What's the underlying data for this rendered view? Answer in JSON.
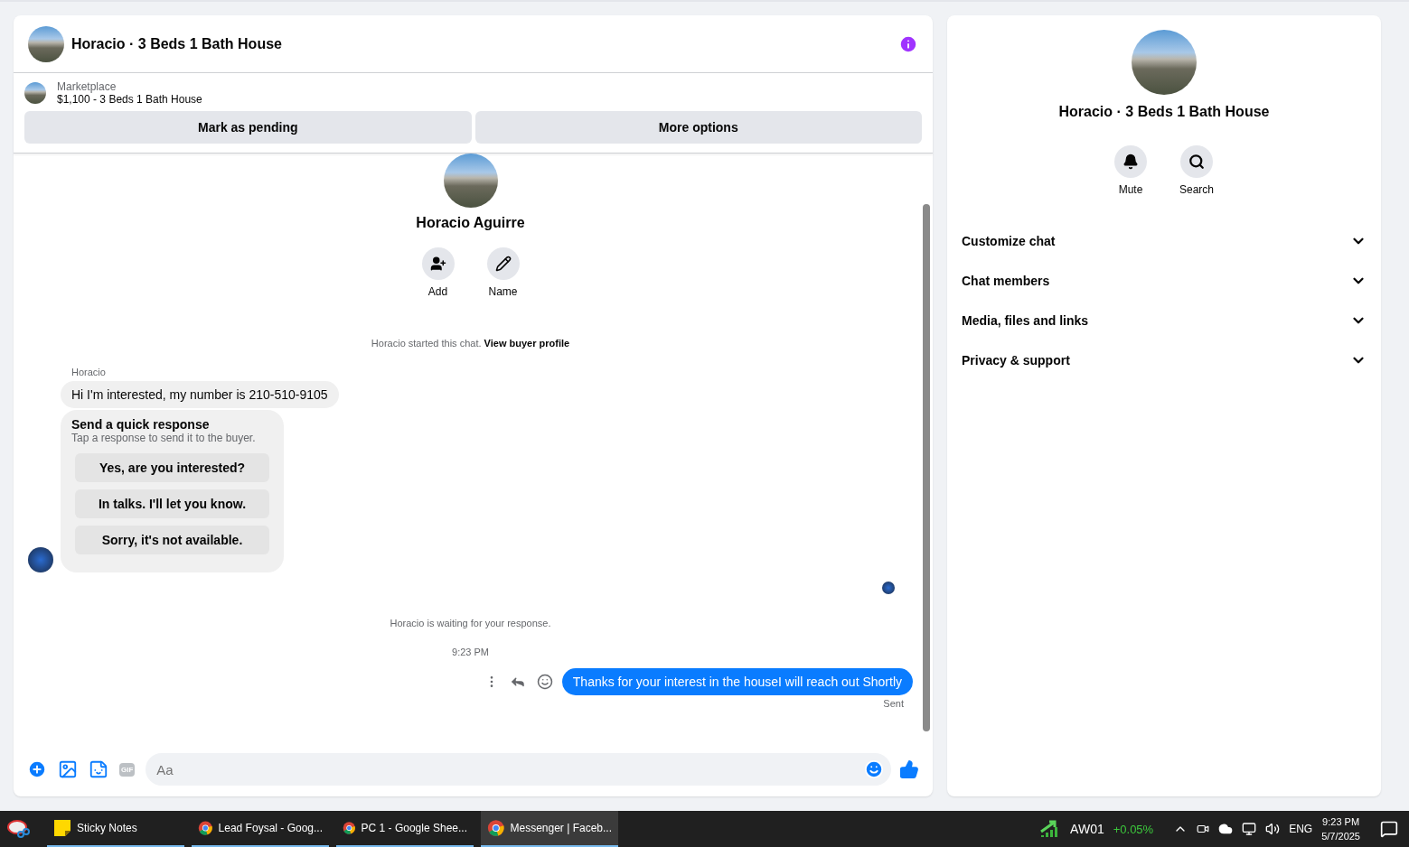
{
  "header": {
    "title": "Horacio · 3 Beds 1 Bath House"
  },
  "listing": {
    "source": "Marketplace",
    "title": "$1,100 - 3 Beds 1 Bath House",
    "actions": [
      "Mark as pending",
      "More options"
    ]
  },
  "profile": {
    "name": "Horacio Aguirre",
    "actions": [
      {
        "label": "Add",
        "kind": "add"
      },
      {
        "label": "Name",
        "kind": "edit"
      }
    ]
  },
  "start_note": {
    "text": "Horacio started this chat.",
    "link": "View buyer profile"
  },
  "incoming": {
    "sender": "Horacio",
    "message": "Hi I'm interested, my number is 210-510-9105"
  },
  "quick_response": {
    "title": "Send a quick response",
    "subtitle": "Tap a response to send it to the buyer.",
    "options": [
      "Yes, are you interested?",
      "In talks. I'll let you know.",
      "Sorry, it's not available."
    ]
  },
  "waiting_note": "Horacio is waiting for your response.",
  "timestamp": "9:23 PM",
  "outgoing": {
    "message": "Thanks for your interest in the houseI will reach out Shortly",
    "status": "Sent"
  },
  "composer": {
    "placeholder": "Aa",
    "gif_label": "GIF"
  },
  "details": {
    "title": "Horacio · 3 Beds 1 Bath House",
    "actions": [
      {
        "label": "Mute",
        "kind": "mute"
      },
      {
        "label": "Search",
        "kind": "search"
      }
    ],
    "sections": [
      {
        "label": "Customize chat",
        "expanded": false
      },
      {
        "label": "Chat members",
        "expanded": false
      },
      {
        "label": "Media, files and links",
        "expanded": false
      },
      {
        "label": "Privacy & support",
        "expanded": false
      }
    ]
  },
  "taskbar": {
    "apps": [
      {
        "label": "Sticky Notes",
        "kind": "notes",
        "selected": false
      },
      {
        "label": "Lead Foysal - Goog...",
        "kind": "browser",
        "selected": false
      },
      {
        "label": "PC 1 - Google Shee...",
        "kind": "browser",
        "selected": false
      },
      {
        "label": "Messenger | Faceb...",
        "kind": "browser",
        "selected": true
      }
    ],
    "ticker": {
      "symbol": "AW01",
      "change": "+0.05%"
    },
    "language": "ENG",
    "time": "9:23 PM",
    "date": "5/7/2025"
  }
}
